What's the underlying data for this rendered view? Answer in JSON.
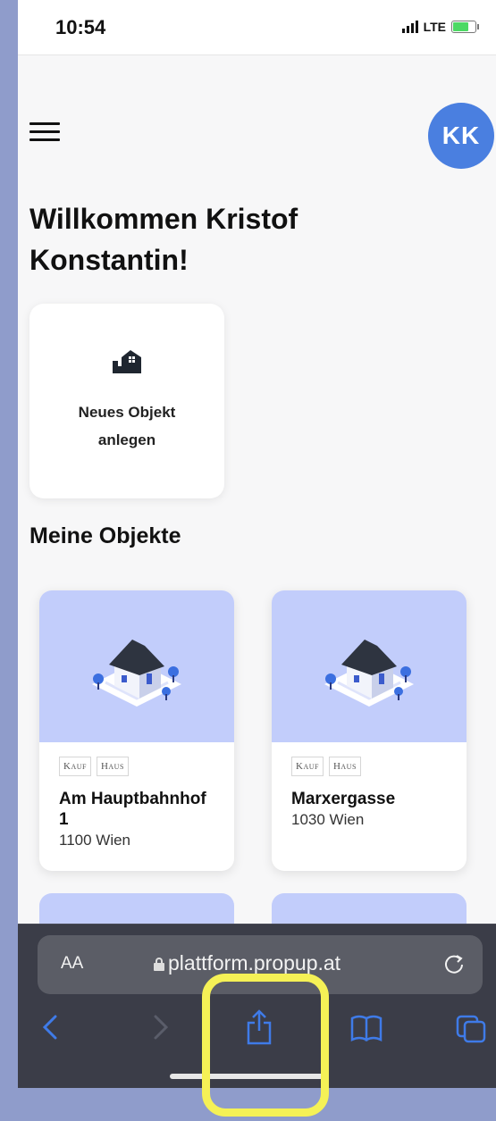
{
  "status": {
    "time": "10:54",
    "network": "LTE"
  },
  "user": {
    "initials": "KK"
  },
  "welcome": {
    "text": "Willkommen Kristof Konstantin!"
  },
  "new_object": {
    "label": "Neues Objekt anlegen"
  },
  "section": {
    "title": "Meine Objekte"
  },
  "objects": [
    {
      "tags": [
        "Kauf",
        "Haus"
      ],
      "title": "Am Hauptbahnhof 1",
      "subtitle": "1100 Wien"
    },
    {
      "tags": [
        "Kauf",
        "Haus"
      ],
      "title": "Marxergasse",
      "subtitle": "1030 Wien"
    }
  ],
  "browser": {
    "text_size_label": "AA",
    "url": "plattform.propup.at"
  },
  "colors": {
    "accent": "#4a7fe0",
    "card_image_bg": "#c2cdfb",
    "highlight": "#f5f156",
    "browser_blue": "#3f7be8"
  }
}
